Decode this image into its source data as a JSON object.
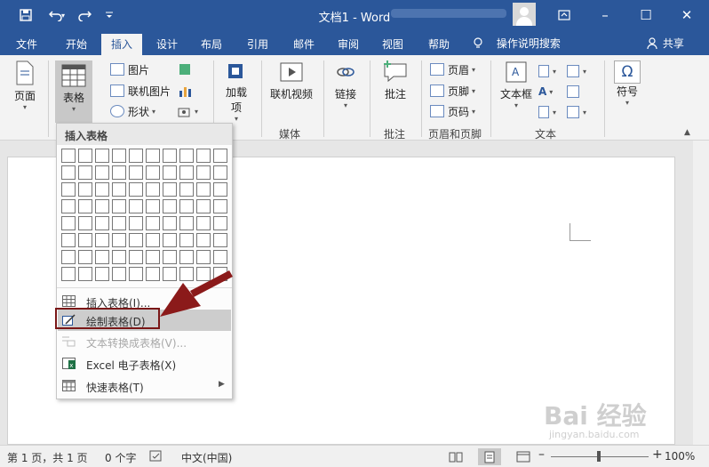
{
  "titlebar": {
    "title": "文档1 - Word",
    "save_icon": "save-icon",
    "undo_icon": "undo-icon",
    "redo_icon": "redo-icon",
    "customize_icon": "customize-qat-icon",
    "restore_icon": "ribbon-display-icon",
    "minimize": "–",
    "maximize": "☐",
    "close": "✕"
  },
  "tabs": [
    "文件",
    "开始",
    "插入",
    "设计",
    "布局",
    "引用",
    "邮件",
    "审阅",
    "视图",
    "帮助"
  ],
  "active_tab": "插入",
  "tell_me": "操作说明搜索",
  "share": "共享",
  "ribbon": {
    "page": "页面",
    "table": "表格",
    "picture": "图片",
    "online_picture": "联机图片",
    "shapes": "形状",
    "addins": "加载\n项",
    "addins_l1": "加载",
    "addins_l2": "项",
    "online_video": "联机视频",
    "link": "链接",
    "comment": "批注",
    "header": "页眉",
    "footer": "页脚",
    "page_number": "页码",
    "textbox": "文本框",
    "symbol": "符号",
    "symbol_glyph": "Ω",
    "groups": {
      "media": "媒体",
      "comments": "批注",
      "header_footer": "页眉和页脚",
      "text": "文本"
    }
  },
  "dropdown": {
    "header": "插入表格",
    "grid_cols": 10,
    "grid_rows": 8,
    "items": [
      {
        "label": "插入表格(I)...",
        "icon": "insert-table-icon",
        "state": "normal"
      },
      {
        "label": "绘制表格(D)",
        "icon": "draw-table-icon",
        "state": "highlighted"
      },
      {
        "label": "文本转换成表格(V)...",
        "icon": "text-to-table-icon",
        "state": "disabled"
      },
      {
        "label": "Excel 电子表格(X)",
        "icon": "excel-icon",
        "state": "normal"
      },
      {
        "label": "快速表格(T)",
        "icon": "quick-table-icon",
        "state": "normal",
        "submenu": "▶"
      }
    ]
  },
  "watermark": {
    "brand": "Bai 经验",
    "url": "jingyan.baidu.com"
  },
  "status": {
    "page": "第 1 页，共 1 页",
    "words": "0 个字",
    "language": "中文(中国)",
    "zoom_minus": "–",
    "zoom_plus": "+",
    "zoom": "100%"
  }
}
